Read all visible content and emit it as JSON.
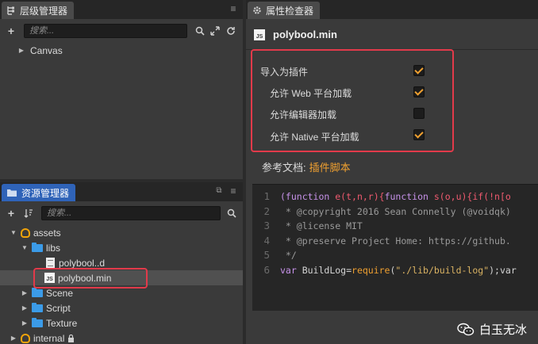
{
  "hierarchy": {
    "tab_label": "层级管理器",
    "search_placeholder": "搜索...",
    "items": [
      {
        "label": "Canvas"
      }
    ]
  },
  "assets": {
    "tab_label": "资源管理器",
    "search_placeholder": "搜索...",
    "items": [
      {
        "label": "assets"
      },
      {
        "label": "libs"
      },
      {
        "label": "polybool..d"
      },
      {
        "label": "polybool.min",
        "badge": "JS"
      },
      {
        "label": "Scene"
      },
      {
        "label": "Script"
      },
      {
        "label": "Texture"
      },
      {
        "label": "internal"
      }
    ]
  },
  "inspector": {
    "tab_label": "属性检查器",
    "file_title": "polybool.min",
    "file_badge": "JS",
    "props": [
      {
        "label": "导入为插件",
        "checked": true
      },
      {
        "label": "允许 Web 平台加载",
        "checked": true
      },
      {
        "label": "允许编辑器加载",
        "checked": false
      },
      {
        "label": "允许 Native 平台加载",
        "checked": true
      }
    ],
    "ref_label": "参考文档:",
    "ref_link": "插件脚本"
  },
  "code": {
    "line_numbers": [
      "1",
      "2",
      "3",
      "4",
      "5",
      "6"
    ],
    "lines": [
      [
        {
          "t": "(function ",
          "c": "k"
        },
        {
          "t": "e(t,n,r){",
          "c": "r"
        },
        {
          "t": "function ",
          "c": "k"
        },
        {
          "t": "s(o,u){",
          "c": "r"
        },
        {
          "t": "if(!n[o",
          "c": "r"
        }
      ],
      [
        {
          "t": " * @copyright 2016 Sean Connelly (@voidqk)",
          "c": "cm"
        }
      ],
      [
        {
          "t": " * @license MIT",
          "c": "cm"
        }
      ],
      [
        {
          "t": " * @preserve Project Home: https://github.",
          "c": "cm"
        }
      ],
      [
        {
          "t": " */",
          "c": "cm"
        }
      ],
      [
        {
          "t": "var ",
          "c": "k"
        },
        {
          "t": "BuildLog=",
          "c": ""
        },
        {
          "t": "require",
          "c": "f"
        },
        {
          "t": "(",
          "c": ""
        },
        {
          "t": "\"./lib/build-log\"",
          "c": "s"
        },
        {
          "t": ");var",
          "c": ""
        }
      ]
    ]
  },
  "watermark": {
    "text": "白玉无冰"
  },
  "colors": {
    "accent_tab": "#2f63b8",
    "checkmark": "#f0a030",
    "highlight": "#e23a4a",
    "link": "#f0a030"
  }
}
